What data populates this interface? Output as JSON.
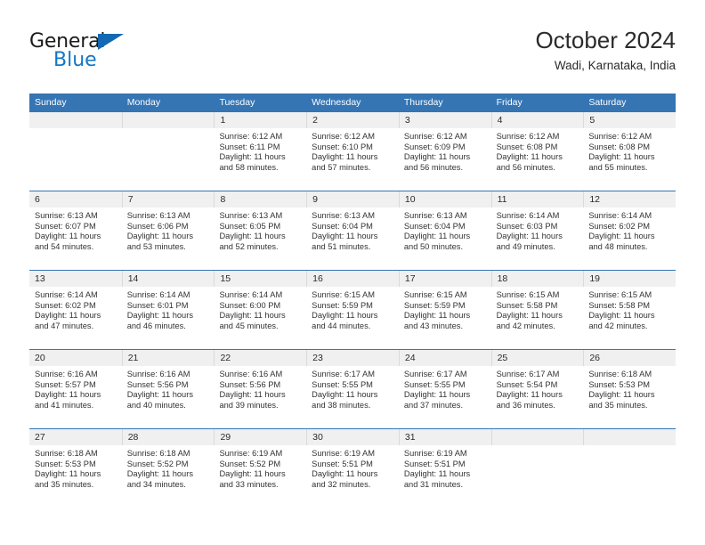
{
  "brand": {
    "name_dark": "General",
    "name_blue": "Blue",
    "accent_color": "#1476c6",
    "triangle_color": "#1268b3"
  },
  "header": {
    "title": "October 2024",
    "subtitle": "Wadi, Karnataka, India"
  },
  "calendar": {
    "header_bg": "#3575b4",
    "daynum_bg": "#f0f0f0",
    "weekdays": [
      "Sunday",
      "Monday",
      "Tuesday",
      "Wednesday",
      "Thursday",
      "Friday",
      "Saturday"
    ],
    "weeks": [
      [
        {
          "day": "",
          "sunrise": "",
          "sunset": "",
          "daylight_line1": "",
          "daylight_line2": ""
        },
        {
          "day": "",
          "sunrise": "",
          "sunset": "",
          "daylight_line1": "",
          "daylight_line2": ""
        },
        {
          "day": "1",
          "sunrise": "Sunrise: 6:12 AM",
          "sunset": "Sunset: 6:11 PM",
          "daylight_line1": "Daylight: 11 hours",
          "daylight_line2": "and 58 minutes."
        },
        {
          "day": "2",
          "sunrise": "Sunrise: 6:12 AM",
          "sunset": "Sunset: 6:10 PM",
          "daylight_line1": "Daylight: 11 hours",
          "daylight_line2": "and 57 minutes."
        },
        {
          "day": "3",
          "sunrise": "Sunrise: 6:12 AM",
          "sunset": "Sunset: 6:09 PM",
          "daylight_line1": "Daylight: 11 hours",
          "daylight_line2": "and 56 minutes."
        },
        {
          "day": "4",
          "sunrise": "Sunrise: 6:12 AM",
          "sunset": "Sunset: 6:08 PM",
          "daylight_line1": "Daylight: 11 hours",
          "daylight_line2": "and 56 minutes."
        },
        {
          "day": "5",
          "sunrise": "Sunrise: 6:12 AM",
          "sunset": "Sunset: 6:08 PM",
          "daylight_line1": "Daylight: 11 hours",
          "daylight_line2": "and 55 minutes."
        }
      ],
      [
        {
          "day": "6",
          "sunrise": "Sunrise: 6:13 AM",
          "sunset": "Sunset: 6:07 PM",
          "daylight_line1": "Daylight: 11 hours",
          "daylight_line2": "and 54 minutes."
        },
        {
          "day": "7",
          "sunrise": "Sunrise: 6:13 AM",
          "sunset": "Sunset: 6:06 PM",
          "daylight_line1": "Daylight: 11 hours",
          "daylight_line2": "and 53 minutes."
        },
        {
          "day": "8",
          "sunrise": "Sunrise: 6:13 AM",
          "sunset": "Sunset: 6:05 PM",
          "daylight_line1": "Daylight: 11 hours",
          "daylight_line2": "and 52 minutes."
        },
        {
          "day": "9",
          "sunrise": "Sunrise: 6:13 AM",
          "sunset": "Sunset: 6:04 PM",
          "daylight_line1": "Daylight: 11 hours",
          "daylight_line2": "and 51 minutes."
        },
        {
          "day": "10",
          "sunrise": "Sunrise: 6:13 AM",
          "sunset": "Sunset: 6:04 PM",
          "daylight_line1": "Daylight: 11 hours",
          "daylight_line2": "and 50 minutes."
        },
        {
          "day": "11",
          "sunrise": "Sunrise: 6:14 AM",
          "sunset": "Sunset: 6:03 PM",
          "daylight_line1": "Daylight: 11 hours",
          "daylight_line2": "and 49 minutes."
        },
        {
          "day": "12",
          "sunrise": "Sunrise: 6:14 AM",
          "sunset": "Sunset: 6:02 PM",
          "daylight_line1": "Daylight: 11 hours",
          "daylight_line2": "and 48 minutes."
        }
      ],
      [
        {
          "day": "13",
          "sunrise": "Sunrise: 6:14 AM",
          "sunset": "Sunset: 6:02 PM",
          "daylight_line1": "Daylight: 11 hours",
          "daylight_line2": "and 47 minutes."
        },
        {
          "day": "14",
          "sunrise": "Sunrise: 6:14 AM",
          "sunset": "Sunset: 6:01 PM",
          "daylight_line1": "Daylight: 11 hours",
          "daylight_line2": "and 46 minutes."
        },
        {
          "day": "15",
          "sunrise": "Sunrise: 6:14 AM",
          "sunset": "Sunset: 6:00 PM",
          "daylight_line1": "Daylight: 11 hours",
          "daylight_line2": "and 45 minutes."
        },
        {
          "day": "16",
          "sunrise": "Sunrise: 6:15 AM",
          "sunset": "Sunset: 5:59 PM",
          "daylight_line1": "Daylight: 11 hours",
          "daylight_line2": "and 44 minutes."
        },
        {
          "day": "17",
          "sunrise": "Sunrise: 6:15 AM",
          "sunset": "Sunset: 5:59 PM",
          "daylight_line1": "Daylight: 11 hours",
          "daylight_line2": "and 43 minutes."
        },
        {
          "day": "18",
          "sunrise": "Sunrise: 6:15 AM",
          "sunset": "Sunset: 5:58 PM",
          "daylight_line1": "Daylight: 11 hours",
          "daylight_line2": "and 42 minutes."
        },
        {
          "day": "19",
          "sunrise": "Sunrise: 6:15 AM",
          "sunset": "Sunset: 5:58 PM",
          "daylight_line1": "Daylight: 11 hours",
          "daylight_line2": "and 42 minutes."
        }
      ],
      [
        {
          "day": "20",
          "sunrise": "Sunrise: 6:16 AM",
          "sunset": "Sunset: 5:57 PM",
          "daylight_line1": "Daylight: 11 hours",
          "daylight_line2": "and 41 minutes."
        },
        {
          "day": "21",
          "sunrise": "Sunrise: 6:16 AM",
          "sunset": "Sunset: 5:56 PM",
          "daylight_line1": "Daylight: 11 hours",
          "daylight_line2": "and 40 minutes."
        },
        {
          "day": "22",
          "sunrise": "Sunrise: 6:16 AM",
          "sunset": "Sunset: 5:56 PM",
          "daylight_line1": "Daylight: 11 hours",
          "daylight_line2": "and 39 minutes."
        },
        {
          "day": "23",
          "sunrise": "Sunrise: 6:17 AM",
          "sunset": "Sunset: 5:55 PM",
          "daylight_line1": "Daylight: 11 hours",
          "daylight_line2": "and 38 minutes."
        },
        {
          "day": "24",
          "sunrise": "Sunrise: 6:17 AM",
          "sunset": "Sunset: 5:55 PM",
          "daylight_line1": "Daylight: 11 hours",
          "daylight_line2": "and 37 minutes."
        },
        {
          "day": "25",
          "sunrise": "Sunrise: 6:17 AM",
          "sunset": "Sunset: 5:54 PM",
          "daylight_line1": "Daylight: 11 hours",
          "daylight_line2": "and 36 minutes."
        },
        {
          "day": "26",
          "sunrise": "Sunrise: 6:18 AM",
          "sunset": "Sunset: 5:53 PM",
          "daylight_line1": "Daylight: 11 hours",
          "daylight_line2": "and 35 minutes."
        }
      ],
      [
        {
          "day": "27",
          "sunrise": "Sunrise: 6:18 AM",
          "sunset": "Sunset: 5:53 PM",
          "daylight_line1": "Daylight: 11 hours",
          "daylight_line2": "and 35 minutes."
        },
        {
          "day": "28",
          "sunrise": "Sunrise: 6:18 AM",
          "sunset": "Sunset: 5:52 PM",
          "daylight_line1": "Daylight: 11 hours",
          "daylight_line2": "and 34 minutes."
        },
        {
          "day": "29",
          "sunrise": "Sunrise: 6:19 AM",
          "sunset": "Sunset: 5:52 PM",
          "daylight_line1": "Daylight: 11 hours",
          "daylight_line2": "and 33 minutes."
        },
        {
          "day": "30",
          "sunrise": "Sunrise: 6:19 AM",
          "sunset": "Sunset: 5:51 PM",
          "daylight_line1": "Daylight: 11 hours",
          "daylight_line2": "and 32 minutes."
        },
        {
          "day": "31",
          "sunrise": "Sunrise: 6:19 AM",
          "sunset": "Sunset: 5:51 PM",
          "daylight_line1": "Daylight: 11 hours",
          "daylight_line2": "and 31 minutes."
        },
        {
          "day": "",
          "sunrise": "",
          "sunset": "",
          "daylight_line1": "",
          "daylight_line2": ""
        },
        {
          "day": "",
          "sunrise": "",
          "sunset": "",
          "daylight_line1": "",
          "daylight_line2": ""
        }
      ]
    ]
  }
}
